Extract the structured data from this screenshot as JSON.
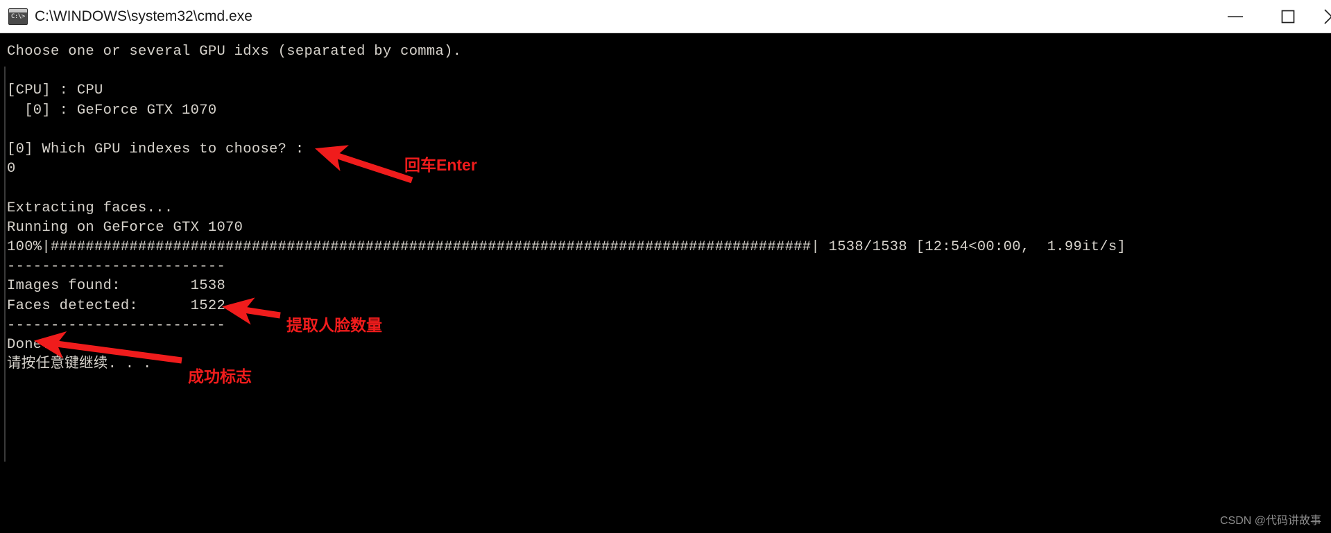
{
  "window": {
    "title": "C:\\WINDOWS\\system32\\cmd.exe",
    "icon": "cmd-icon",
    "prompt_glyph": "C:\\>",
    "controls": {
      "minimize_label": "Minimize",
      "maximize_label": "Maximize",
      "close_label": "Close"
    },
    "titlebar_bg": "#ffffff",
    "titlebar_fg": "#1b1b1b"
  },
  "terminal": {
    "background": "#000000",
    "foreground": "#d7d3cc",
    "lines": [
      "Choose one or several GPU idxs (separated by comma).",
      "",
      "[CPU] : CPU",
      "  [0] : GeForce GTX 1070",
      "",
      "[0] Which GPU indexes to choose? :",
      "0",
      "",
      "Extracting faces...",
      "Running on GeForce GTX 1070",
      "100%|#######################################################################################| 1538/1538 [12:54<00:00,  1.99it/s]",
      "-------------------------",
      "Images found:        1538",
      "Faces detected:      1522",
      "-------------------------",
      "Done.",
      "请按任意键继续. . ."
    ],
    "progress": {
      "percent": "100%",
      "current": "1538",
      "total": "1538",
      "elapsed": "12:54",
      "remaining": "00:00",
      "rate": "1.99it/s"
    },
    "summary": {
      "images_found_label": "Images found:",
      "images_found_value": "1538",
      "faces_detected_label": "Faces detected:",
      "faces_detected_value": "1522",
      "done_label": "Done.",
      "press_any_key": "请按任意键继续. . ."
    },
    "gpu": {
      "cpu_entry": "[CPU] : CPU",
      "gpu_entry": "  [0] : GeForce GTX 1070",
      "question": "[0] Which GPU indexes to choose? :",
      "answer": "0"
    }
  },
  "annotations": {
    "color": "#f01c1c",
    "items": [
      {
        "label": "回车Enter"
      },
      {
        "label": "提取人脸数量"
      },
      {
        "label": "成功标志"
      }
    ]
  },
  "watermark": {
    "text": "CSDN @代码讲故事"
  }
}
